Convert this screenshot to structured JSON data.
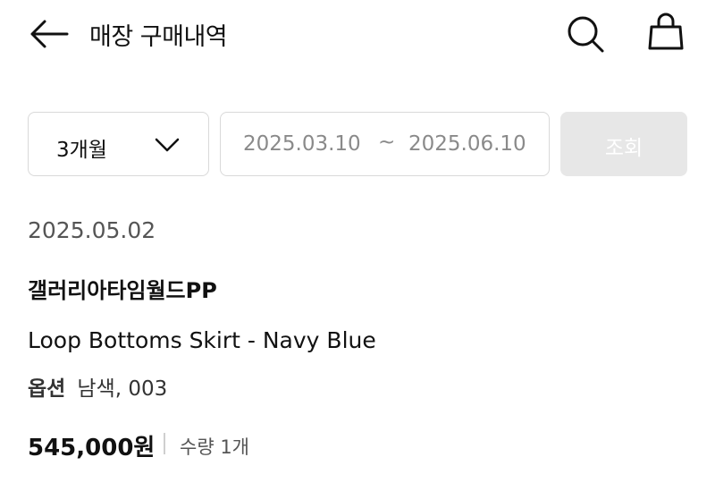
{
  "header": {
    "title": "매장 구매내역",
    "back_icon": "arrow-left-icon",
    "search_icon": "search-icon",
    "bag_icon": "shopping-bag-icon"
  },
  "filter": {
    "period": "3개월",
    "period_icon": "chevron-down-icon",
    "date_start": "2025.03.10",
    "date_separator": "~",
    "date_end": "2025.06.10",
    "search_button": "조회"
  },
  "order": {
    "date": "2025.05.02",
    "store": "갤러리아타임월드PP",
    "product": "Loop Bottoms Skirt - Navy Blue",
    "option_label": "옵션",
    "option_value": "남색, 003",
    "price": "545,000원",
    "quantity": "수량 1개"
  },
  "colors": {
    "text": "#111111",
    "muted": "#8a8a8a",
    "border": "#d9d9d9",
    "disabled_button": "#e7e7e7"
  }
}
